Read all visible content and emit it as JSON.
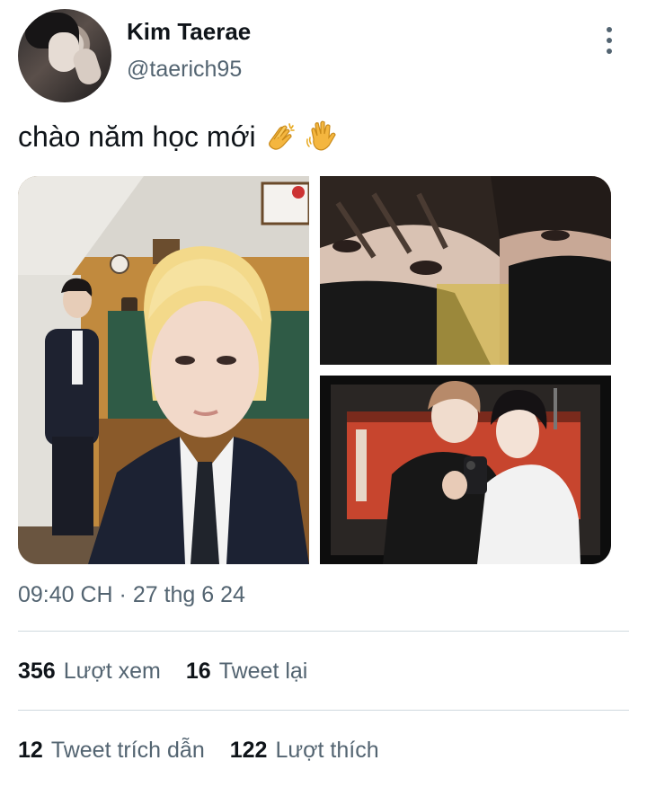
{
  "author": {
    "display_name": "Kim Taerae",
    "handle": "@taerich95"
  },
  "tweet": {
    "text": "chào năm học mới",
    "emojis": [
      "clapping-hands-icon",
      "waving-hand-icon"
    ],
    "timestamp": "09:40 CH · 27 thg 6 24"
  },
  "media": {
    "photos": [
      {
        "name": "photo-classroom-selfie"
      },
      {
        "name": "photo-masked-selfie"
      },
      {
        "name": "photo-mirror-selfie"
      }
    ]
  },
  "stats": {
    "views": {
      "count": "356",
      "label": "Lượt xem"
    },
    "retweets": {
      "count": "16",
      "label": "Tweet lại"
    },
    "quotes": {
      "count": "12",
      "label": "Tweet trích dẫn"
    },
    "likes": {
      "count": "122",
      "label": "Lượt thích"
    }
  },
  "colors": {
    "text_primary": "#0f1419",
    "text_secondary": "#536471",
    "divider": "#cfd9de"
  }
}
